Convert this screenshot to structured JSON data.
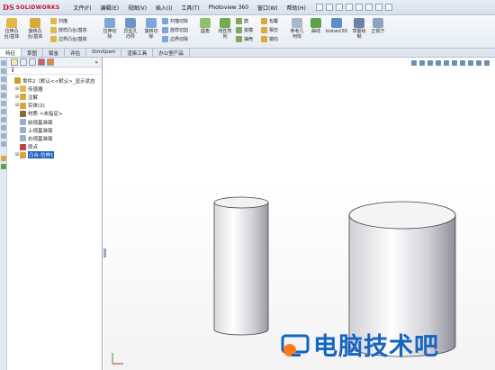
{
  "app": {
    "brand": "SOLIDWORKS",
    "menu": [
      "文件(F)",
      "编辑(E)",
      "视图(V)",
      "插入(I)",
      "工具(T)",
      "Photoview 360",
      "窗口(W)",
      "帮助(H)"
    ]
  },
  "ribbon": {
    "big_buttons": [
      {
        "label": "拉伸凸\n台/基体"
      },
      {
        "label": "旋转凸\n台/基体"
      },
      {
        "label": "拉伸切\n除"
      },
      {
        "label": "异型孔\n向导"
      },
      {
        "label": "旋转切\n除"
      },
      {
        "label": "圆角"
      },
      {
        "label": "线性阵\n列"
      },
      {
        "label": "参考几\n何体"
      },
      {
        "label": "曲线"
      },
      {
        "label": "Instant3D"
      },
      {
        "label": "草图绘\n制"
      },
      {
        "label": "正视于"
      }
    ],
    "small_items": [
      "扫描",
      "放样凸台/基体",
      "边界凸台/基体",
      "扫描切除",
      "放样切割",
      "边界切除",
      "筋",
      "拔模",
      "抽壳",
      "包覆",
      "相交",
      "镜向"
    ]
  },
  "command_tabs": [
    "特征",
    "草图",
    "钣金",
    "评估",
    "DimXpert",
    "渲染工具",
    "办公室产品"
  ],
  "feature_tree": {
    "filter_icon": "filter-icon",
    "items": [
      {
        "label": "零件2（默认<<默认>_显示状态",
        "icon": "part-icon",
        "color": "#c9a227"
      },
      {
        "label": "传感器",
        "icon": "sensor-icon",
        "color": "#e5b64a"
      },
      {
        "label": "注解",
        "icon": "annotation-icon",
        "color": "#d9a63a"
      },
      {
        "label": "实体(2)",
        "icon": "solid-bodies-icon",
        "color": "#d9a63a"
      },
      {
        "label": "材质 <未指定>",
        "icon": "material-icon",
        "color": "#8b6b3e"
      },
      {
        "label": "前视基准面",
        "icon": "plane-icon",
        "color": "#9bb0c8"
      },
      {
        "label": "上视基准面",
        "icon": "plane-icon",
        "color": "#9bb0c8"
      },
      {
        "label": "右视基准面",
        "icon": "plane-icon",
        "color": "#9bb0c8"
      },
      {
        "label": "原点",
        "icon": "origin-icon",
        "color": "#c04040"
      },
      {
        "label": "凸台-拉伸1",
        "icon": "extrude-icon",
        "color": "#d9a63a",
        "selected": true
      }
    ]
  },
  "watermark": {
    "text": "电脑技术吧",
    "color": "#1565c0"
  }
}
